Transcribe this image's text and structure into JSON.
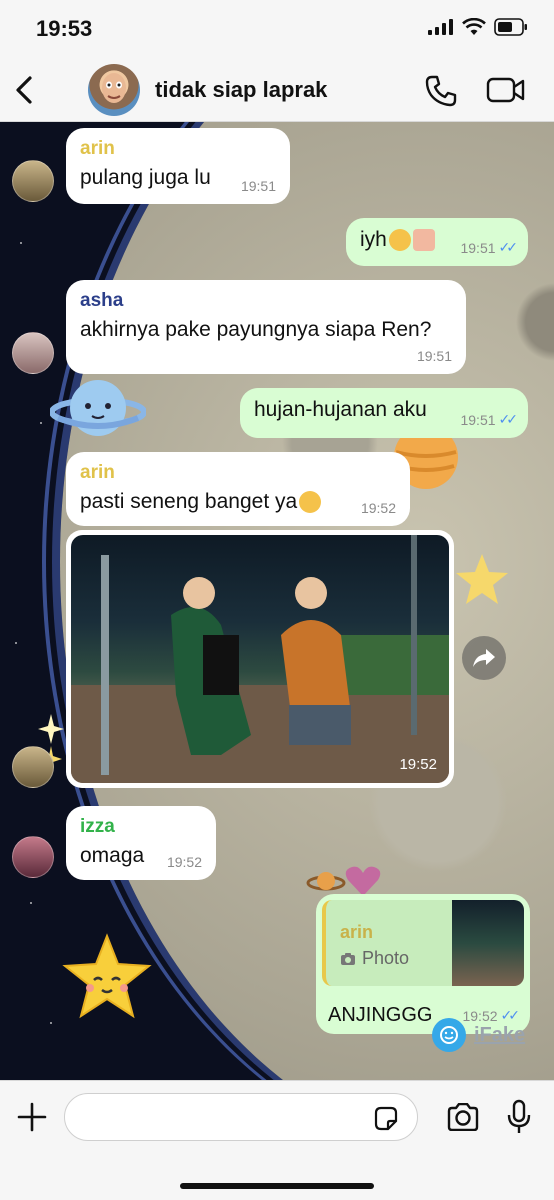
{
  "status_bar": {
    "time": "19:53"
  },
  "header": {
    "title": "tidak siap laprak",
    "icons": [
      "back-icon",
      "phone-icon",
      "video-icon"
    ]
  },
  "colors": {
    "sender_arin": "#e0c24a",
    "sender_asha": "#2c3f8a",
    "sender_izza": "#32b24a",
    "out_bubble": "#d9fdd3",
    "read_ticks": "#4f8ff0"
  },
  "messages": [
    {
      "sender": "arin",
      "text": "pulang juga lu",
      "time": "19:51"
    },
    {
      "text": "iyh",
      "time": "19:51",
      "status": "read"
    },
    {
      "sender": "asha",
      "text": "akhirnya pake payungnya siapa Ren?",
      "time": "19:51"
    },
    {
      "text": "hujan-hujanan aku",
      "time": "19:51",
      "status": "read"
    },
    {
      "sender": "arin",
      "text": "pasti seneng banget ya",
      "time": "19:52"
    },
    {
      "photo_time": "19:52"
    },
    {
      "sender": "izza",
      "text": "omaga",
      "time": "19:52"
    },
    {
      "reply_to": "arin",
      "reply_type": "Photo",
      "text": "ANJINGGG",
      "time": "19:52",
      "status": "read"
    }
  ],
  "watermark": "iFake",
  "input": {
    "placeholder": ""
  }
}
